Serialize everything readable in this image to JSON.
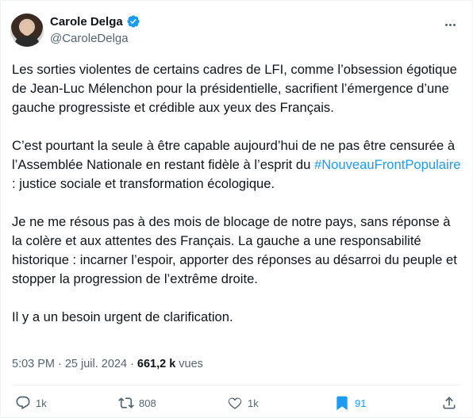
{
  "author": {
    "name": "Carole Delga",
    "handle": "@CaroleDelga"
  },
  "tweet": {
    "paragraphs": [
      "Les sorties violentes de certains cadres de LFI, comme l’obsession égotique de Jean-Luc Mélenchon pour la présidentielle, sacrifient l’émergence d’une gauche progressiste et crédible aux yeux des Français.",
      "C’est pourtant la seule à être capable aujourd’hui de ne pas être censurée à l’Assemblée Nationale en restant fidèle à l’esprit du",
      "Je ne me résous pas à des mois de blocage de notre pays, sans réponse à la colère et aux attentes des Français. La gauche a une responsabilité historique : incarner l’espoir, apporter des réponses au désarroi du peuple et stopper la progression de l’extrême droite.",
      "Il y a un besoin urgent de clarification."
    ],
    "hashtag": "#NouveauFrontPopulaire",
    "after_hashtag": " : justice sociale et transformation écologique."
  },
  "meta": {
    "time": "5:03 PM",
    "separator": "·",
    "date": "25 juil. 2024",
    "views_count": "661,2 k",
    "views_label": "vues"
  },
  "actions": {
    "replies": "1k",
    "reposts": "808",
    "likes": "1k",
    "bookmarks": "91"
  },
  "colors": {
    "accent": "#1d9bf0",
    "secondary_text": "#536471",
    "primary_text": "#0f1419"
  },
  "icons": [
    "verified-badge-icon",
    "more-icon",
    "reply-icon",
    "repost-icon",
    "like-icon",
    "bookmark-icon",
    "share-icon"
  ]
}
